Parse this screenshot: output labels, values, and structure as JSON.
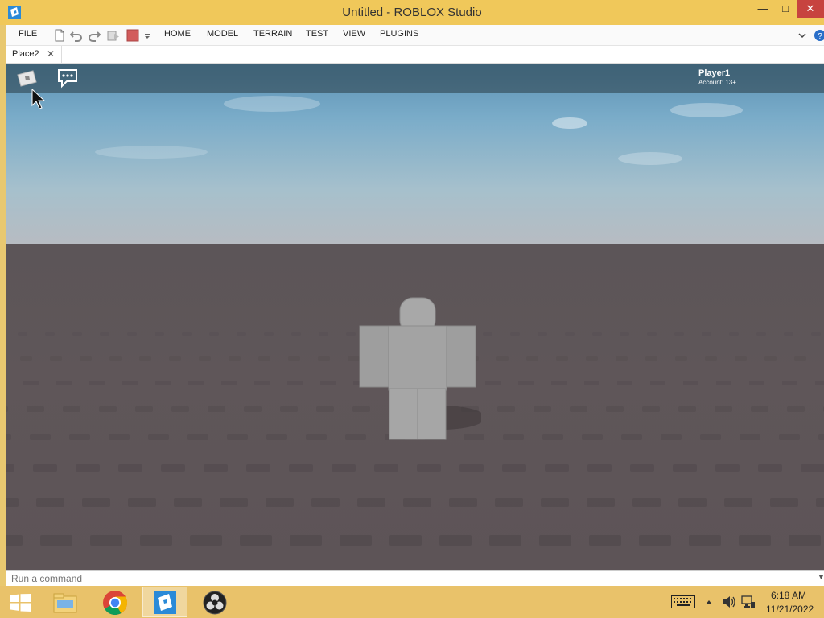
{
  "window": {
    "title": "Untitled - ROBLOX Studio",
    "minimize": "—",
    "maximize": "□",
    "close": "✕",
    "app_icon": "roblox-studio-icon"
  },
  "menubar": {
    "file": "FILE",
    "tabs": [
      "HOME",
      "MODEL",
      "TERRAIN",
      "TEST",
      "VIEW",
      "PLUGINS"
    ],
    "quick_access_icons": [
      "new-file-icon",
      "undo-icon",
      "redo-icon",
      "play-icon",
      "stop-icon",
      "customize-dropdown-icon"
    ],
    "right_icons": [
      "collapse-ribbon-icon",
      "help-icon"
    ]
  },
  "document_tab": {
    "label": "Place2",
    "close": "✕"
  },
  "game_view": {
    "player_name": "Player1",
    "account_label": "Account: 13+",
    "colors": {
      "sky": "#7aacc9",
      "ground": "#5f5659",
      "avatar": "#a3a3a3"
    }
  },
  "command_bar": {
    "placeholder": "Run a command"
  },
  "taskbar": {
    "apps": [
      "windows-start-icon",
      "file-explorer-icon",
      "chrome-icon",
      "roblox-studio-icon",
      "obs-icon"
    ],
    "active_app": "roblox-studio-icon",
    "tray_icons": [
      "keyboard-icon",
      "show-hidden-icons-icon",
      "volume-icon",
      "network-icon"
    ],
    "time": "6:18 AM",
    "date": "11/21/2022"
  }
}
